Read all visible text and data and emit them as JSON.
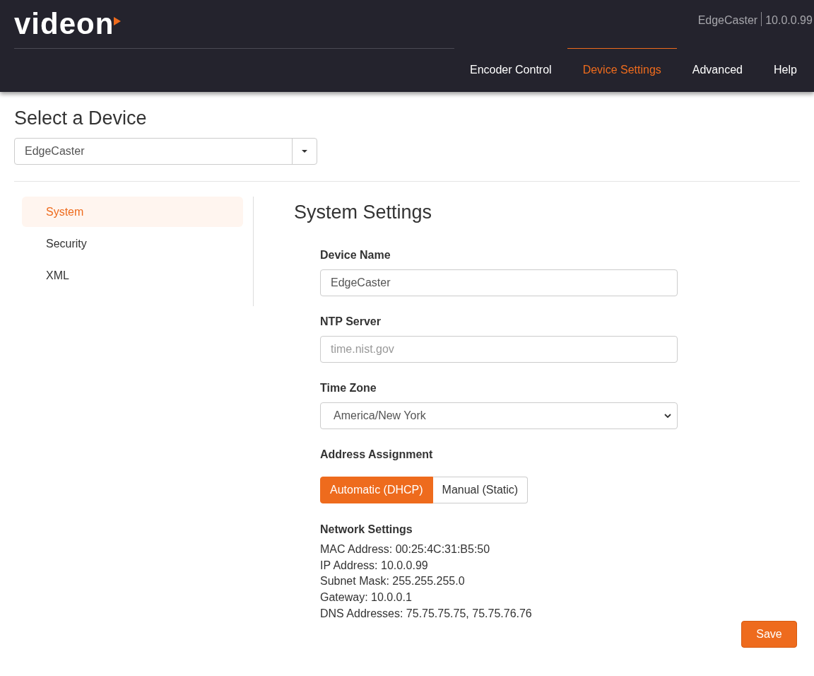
{
  "header": {
    "logo": "videon",
    "device_name": "EdgeCaster",
    "device_ip": "10.0.0.99",
    "nav": [
      {
        "label": "Encoder Control",
        "selected": false
      },
      {
        "label": "Device Settings",
        "selected": true
      },
      {
        "label": "Advanced",
        "selected": false
      },
      {
        "label": "Help",
        "selected": false
      }
    ]
  },
  "device_select": {
    "title": "Select a Device",
    "value": "EdgeCaster"
  },
  "sidebar": {
    "items": [
      {
        "label": "System",
        "selected": true
      },
      {
        "label": "Security",
        "selected": false
      },
      {
        "label": "XML",
        "selected": false
      }
    ]
  },
  "settings": {
    "title": "System Settings",
    "device_name": {
      "label": "Device Name",
      "value": "EdgeCaster"
    },
    "ntp_server": {
      "label": "NTP Server",
      "placeholder": "time.nist.gov"
    },
    "time_zone": {
      "label": "Time Zone",
      "value": "America/New York"
    },
    "address_assignment": {
      "label": "Address Assignment",
      "options": [
        {
          "label": "Automatic (DHCP)",
          "selected": true
        },
        {
          "label": "Manual (Static)",
          "selected": false
        }
      ]
    },
    "network": {
      "title": "Network Settings",
      "lines": [
        "MAC Address: 00:25:4C:31:B5:50",
        "IP Address: 10.0.0.99",
        "Subnet Mask: 255.255.255.0",
        "Gateway: 10.0.0.1",
        "DNS Addresses: 75.75.75.75, 75.75.76.76"
      ]
    },
    "save": "Save"
  }
}
